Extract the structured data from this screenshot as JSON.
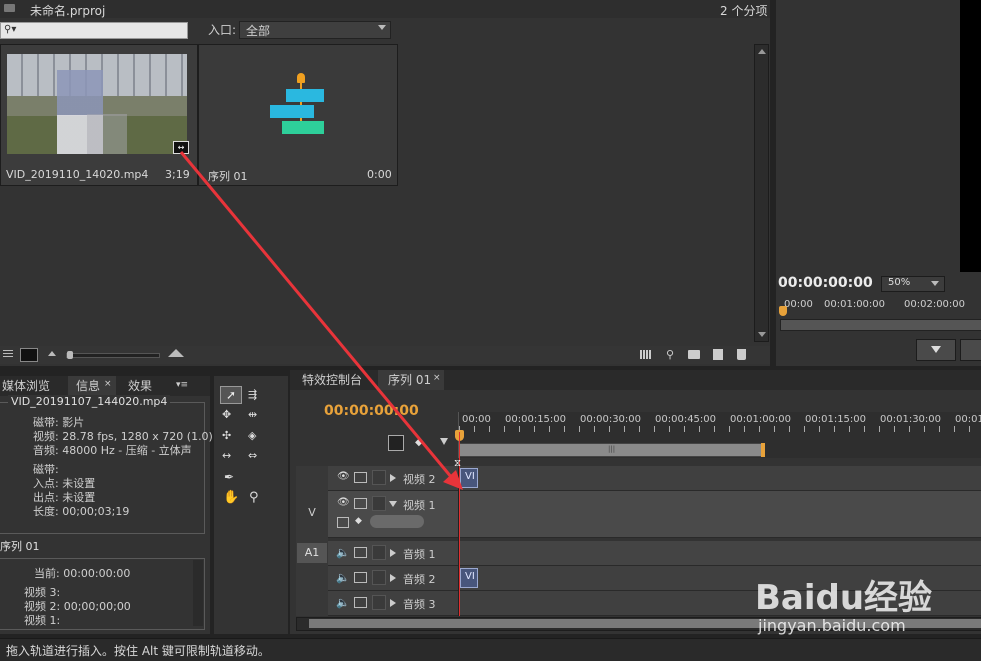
{
  "project": {
    "title": "未命名.prproj",
    "item_count": "2 个分项",
    "search_placeholder": "",
    "entry_label": "入口:",
    "entry_value": "全部",
    "items": [
      {
        "name": "VID_20191107_144020.mp4",
        "name_visible": "VID_2019110_14020.mp4",
        "duration": "3;19"
      },
      {
        "name": "序列 01",
        "duration": "0:00"
      }
    ]
  },
  "monitor": {
    "timecode": "00:00:00:00",
    "zoom": "50%",
    "ruler": [
      "00:00",
      "00:01:00:00",
      "00:02:00:00"
    ]
  },
  "lower_left_tabs": [
    "媒体浏览",
    "信息",
    "效果"
  ],
  "info": {
    "clip_name": "VID_20191107_144020.mp4",
    "lines1": [
      {
        "k": "磁带:",
        "v": "影片"
      },
      {
        "k": "视频:",
        "v": "28.78 fps, 1280 x 720 (1.0)"
      },
      {
        "k": "音频:",
        "v": "48000 Hz - 压缩 - 立体声"
      },
      {
        "k": "磁带:",
        "v": ""
      },
      {
        "k": "入点:",
        "v": "未设置"
      },
      {
        "k": "出点:",
        "v": "未设置"
      },
      {
        "k": "长度:",
        "v": "00;00;03;19"
      }
    ],
    "seq_name": "序列 01",
    "current_label": "当前:",
    "current_value": "00:00:00:00",
    "lines2": [
      {
        "k": "视频 3:",
        "v": ""
      },
      {
        "k": "视频 2:",
        "v": "00;00;00;00"
      },
      {
        "k": "视频 1:",
        "v": ""
      }
    ]
  },
  "timeline": {
    "tabs": [
      "特效控制台",
      "序列 01"
    ],
    "timecode": "00:00:00:00",
    "ruler": [
      "00:00",
      "00:00:15:00",
      "00:00:30:00",
      "00:00:45:00",
      "00:01:00:00",
      "00:01:15:00",
      "00:01:30:00",
      "00:01"
    ],
    "tracks": [
      {
        "label": "视频 2",
        "clip": "VI",
        "target": ""
      },
      {
        "label": "视频 1",
        "clip": "",
        "target": "V"
      },
      {
        "label": "音频 1",
        "clip": "",
        "target": "A1"
      },
      {
        "label": "音频 2",
        "clip": "VI",
        "target": ""
      },
      {
        "label": "音频 3",
        "clip": "",
        "target": ""
      }
    ]
  },
  "status_bar": "拖入轨道进行插入。按住 Alt 键可限制轨道移动。",
  "watermark": {
    "brand": "Baidu经验",
    "url": "jingyan.baidu.com"
  },
  "colors": {
    "accent": "#e8a23a",
    "arrow": "#e8343a",
    "playhead": "#e03030"
  }
}
